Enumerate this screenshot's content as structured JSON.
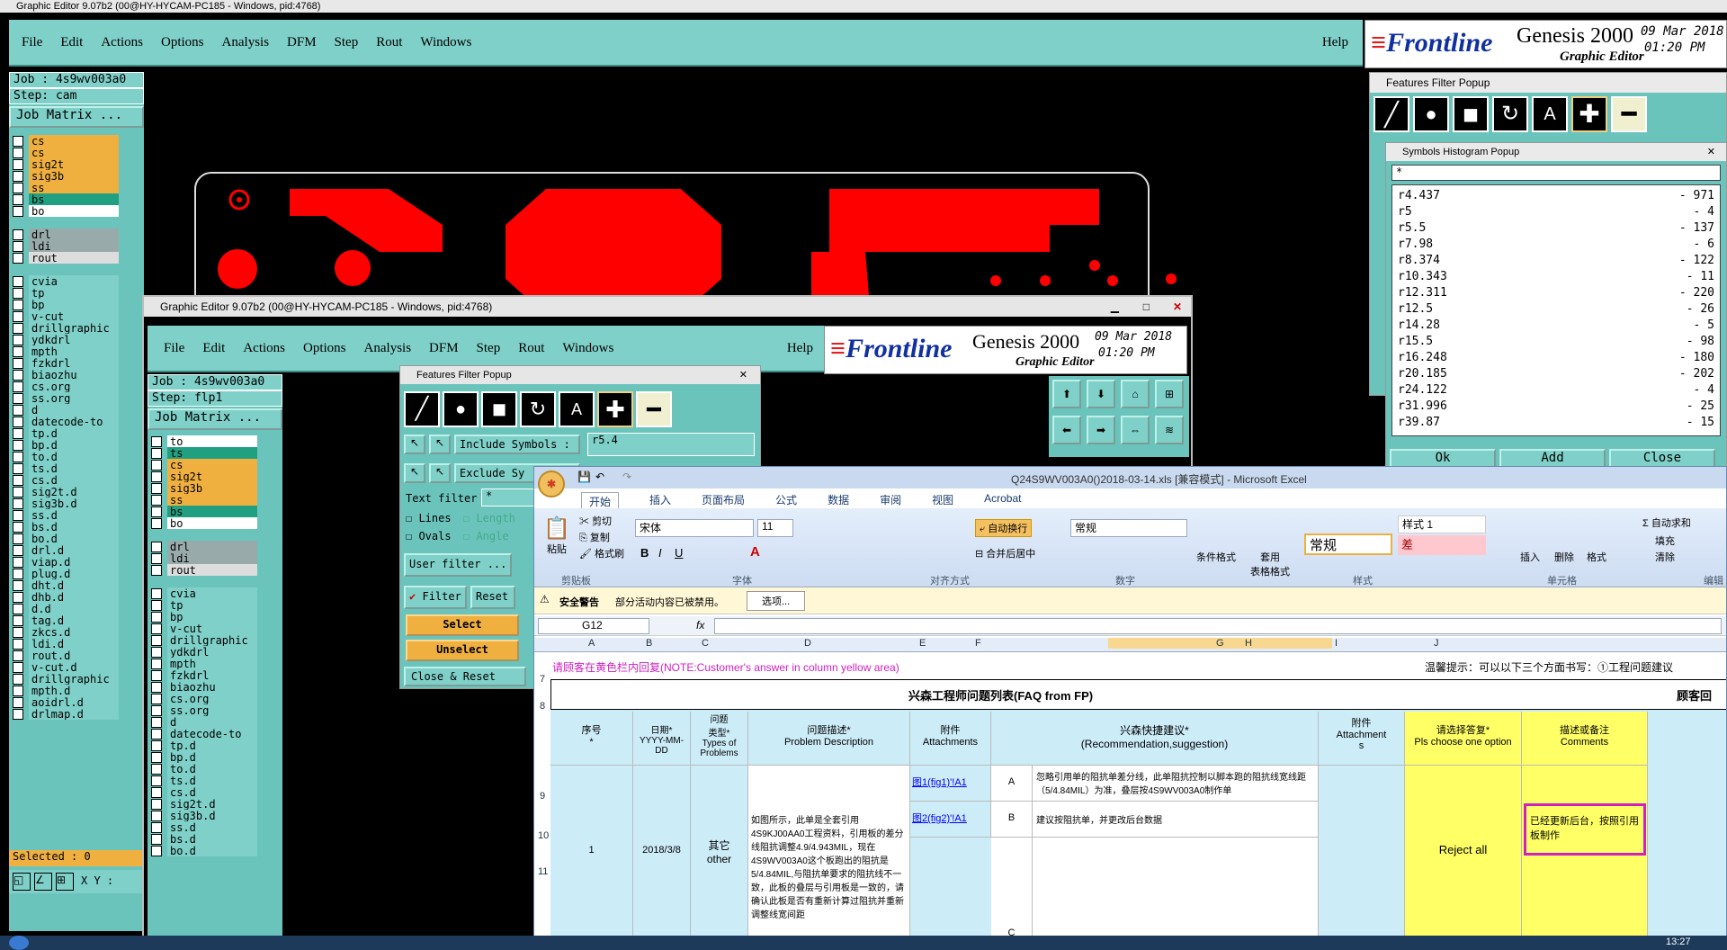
{
  "ge_back": {
    "title": "Graphic Editor 9.07b2 (00@HY-HYCAM-PC185 - Windows, pid:4768)",
    "menu": [
      "File",
      "Edit",
      "Actions",
      "Options",
      "Analysis",
      "DFM",
      "Step",
      "Rout",
      "Windows"
    ],
    "help": "Help",
    "job": "Job : 4s9wv003a0",
    "step": "Step: cam",
    "matrix": "Job Matrix ...",
    "selected": "Selected : 0",
    "xy": "X Y :",
    "layers": [
      {
        "n": "cs",
        "c": "#f0b040"
      },
      {
        "n": "cs",
        "c": "#f0b040"
      },
      {
        "n": "sig2t",
        "c": "#f0b040"
      },
      {
        "n": "sig3b",
        "c": "#f0b040"
      },
      {
        "n": "ss",
        "c": "#f0b040"
      },
      {
        "n": "bs",
        "c": "#20a080"
      },
      {
        "n": "bo",
        "c": "#ffffff"
      },
      {
        "n": "",
        "c": ""
      },
      {
        "n": "drl",
        "c": "#9aa"
      },
      {
        "n": "ldi",
        "c": "#9aa"
      },
      {
        "n": "rout",
        "c": "#ddd"
      },
      {
        "n": "",
        "c": ""
      },
      {
        "n": "cvia",
        "c": "#7fd0c8"
      },
      {
        "n": "tp",
        "c": "#7fd0c8"
      },
      {
        "n": "bp",
        "c": "#7fd0c8"
      },
      {
        "n": "v-cut",
        "c": "#7fd0c8"
      },
      {
        "n": "drillgraphic",
        "c": "#7fd0c8"
      },
      {
        "n": "ydkdrl",
        "c": "#7fd0c8"
      },
      {
        "n": "mpth",
        "c": "#7fd0c8"
      },
      {
        "n": "fzkdrl",
        "c": "#7fd0c8"
      },
      {
        "n": "biaozhu",
        "c": "#7fd0c8"
      },
      {
        "n": "cs.org",
        "c": "#7fd0c8"
      },
      {
        "n": "ss.org",
        "c": "#7fd0c8"
      },
      {
        "n": "d",
        "c": "#7fd0c8"
      },
      {
        "n": "datecode-to",
        "c": "#7fd0c8"
      },
      {
        "n": "tp.d",
        "c": "#7fd0c8"
      },
      {
        "n": "bp.d",
        "c": "#7fd0c8"
      },
      {
        "n": "to.d",
        "c": "#7fd0c8"
      },
      {
        "n": "ts.d",
        "c": "#7fd0c8"
      },
      {
        "n": "cs.d",
        "c": "#7fd0c8"
      },
      {
        "n": "sig2t.d",
        "c": "#7fd0c8"
      },
      {
        "n": "sig3b.d",
        "c": "#7fd0c8"
      },
      {
        "n": "ss.d",
        "c": "#7fd0c8"
      },
      {
        "n": "bs.d",
        "c": "#7fd0c8"
      },
      {
        "n": "bo.d",
        "c": "#7fd0c8"
      },
      {
        "n": "drl.d",
        "c": "#7fd0c8"
      },
      {
        "n": "viap.d",
        "c": "#7fd0c8"
      },
      {
        "n": "plug.d",
        "c": "#7fd0c8"
      },
      {
        "n": "dht.d",
        "c": "#7fd0c8"
      },
      {
        "n": "dhb.d",
        "c": "#7fd0c8"
      },
      {
        "n": "d.d",
        "c": "#7fd0c8"
      },
      {
        "n": "tag.d",
        "c": "#7fd0c8"
      },
      {
        "n": "zkcs.d",
        "c": "#7fd0c8"
      },
      {
        "n": "ldi.d",
        "c": "#7fd0c8"
      },
      {
        "n": "rout.d",
        "c": "#7fd0c8"
      },
      {
        "n": "v-cut.d",
        "c": "#7fd0c8"
      },
      {
        "n": "drillgraphic",
        "c": "#7fd0c8"
      },
      {
        "n": "mpth.d",
        "c": "#7fd0c8"
      },
      {
        "n": "aoidrl.d",
        "c": "#7fd0c8"
      },
      {
        "n": "drlmap.d",
        "c": "#7fd0c8"
      }
    ]
  },
  "frontline": {
    "brand": "Frontline",
    "product": "Genesis 2000",
    "sub": "Graphic Editor",
    "date": "09 Mar 2018",
    "time": "01:20 PM"
  },
  "ge_front": {
    "title": "Graphic Editor 9.07b2 (00@HY-HYCAM-PC185 - Windows, pid:4768)",
    "job": "Job : 4s9wv003a0",
    "step": "Step: flp1",
    "matrix": "Job Matrix ...",
    "layers": [
      {
        "n": "to",
        "c": "#ffffff"
      },
      {
        "n": "ts",
        "c": "#20a080"
      },
      {
        "n": "cs",
        "c": "#f0b040"
      },
      {
        "n": "sig2t",
        "c": "#f0b040"
      },
      {
        "n": "sig3b",
        "c": "#f0b040"
      },
      {
        "n": "ss",
        "c": "#f0b040"
      },
      {
        "n": "bs",
        "c": "#20a080"
      },
      {
        "n": "bo",
        "c": "#ffffff"
      },
      {
        "n": "",
        "c": ""
      },
      {
        "n": "drl",
        "c": "#9aa"
      },
      {
        "n": "ldi",
        "c": "#9aa"
      },
      {
        "n": "rout",
        "c": "#ddd"
      },
      {
        "n": "",
        "c": ""
      },
      {
        "n": "cvia",
        "c": "#7fd0c8"
      },
      {
        "n": "tp",
        "c": "#7fd0c8"
      },
      {
        "n": "bp",
        "c": "#7fd0c8"
      },
      {
        "n": "v-cut",
        "c": "#7fd0c8"
      },
      {
        "n": "drillgraphic",
        "c": "#7fd0c8"
      },
      {
        "n": "ydkdrl",
        "c": "#7fd0c8"
      },
      {
        "n": "mpth",
        "c": "#7fd0c8"
      },
      {
        "n": "fzkdrl",
        "c": "#7fd0c8"
      },
      {
        "n": "biaozhu",
        "c": "#7fd0c8"
      },
      {
        "n": "cs.org",
        "c": "#7fd0c8"
      },
      {
        "n": "ss.org",
        "c": "#7fd0c8"
      },
      {
        "n": "d",
        "c": "#7fd0c8"
      },
      {
        "n": "datecode-to",
        "c": "#7fd0c8"
      },
      {
        "n": "tp.d",
        "c": "#7fd0c8"
      },
      {
        "n": "bp.d",
        "c": "#7fd0c8"
      },
      {
        "n": "to.d",
        "c": "#7fd0c8"
      },
      {
        "n": "ts.d",
        "c": "#7fd0c8"
      },
      {
        "n": "cs.d",
        "c": "#7fd0c8"
      },
      {
        "n": "sig2t.d",
        "c": "#7fd0c8"
      },
      {
        "n": "sig3b.d",
        "c": "#7fd0c8"
      },
      {
        "n": "ss.d",
        "c": "#7fd0c8"
      },
      {
        "n": "bs.d",
        "c": "#7fd0c8"
      },
      {
        "n": "bo.d",
        "c": "#7fd0c8"
      }
    ]
  },
  "ffp_small": {
    "title": "Features Filter Popup",
    "include": "Include Symbols :",
    "include_val": "r5.4",
    "exclude": "Exclude Sy",
    "text_filter": "Text filter",
    "text_val": "*",
    "lines": "Lines",
    "length": "Length",
    "ovals": "Ovals",
    "angle": "Angle",
    "user_filter": "User filter ...",
    "filter": "Filter",
    "reset": "Reset",
    "select": "Select",
    "unselect": "Unselect",
    "close": "Close & Reset"
  },
  "ffp_right": {
    "title": "Features Filter Popup"
  },
  "histo": {
    "title": "Symbols Histogram Popup",
    "filter": "*",
    "rows": [
      {
        "s": "r4.437",
        "c": "- 971"
      },
      {
        "s": "r5",
        "c": "- 4"
      },
      {
        "s": "r5.5",
        "c": "- 137"
      },
      {
        "s": "r7.98",
        "c": "- 6"
      },
      {
        "s": "r8.374",
        "c": "- 122"
      },
      {
        "s": "r10.343",
        "c": "- 11"
      },
      {
        "s": "r12.311",
        "c": "- 220"
      },
      {
        "s": "r12.5",
        "c": "- 26"
      },
      {
        "s": "r14.28",
        "c": "- 5"
      },
      {
        "s": "r15.5",
        "c": "- 98"
      },
      {
        "s": "r16.248",
        "c": "- 180"
      },
      {
        "s": "r20.185",
        "c": "- 202"
      },
      {
        "s": "r24.122",
        "c": "- 4"
      },
      {
        "s": "r31.996",
        "c": "- 25"
      },
      {
        "s": "r39.87",
        "c": "- 15"
      }
    ],
    "ok": "Ok",
    "add": "Add",
    "close": "Close"
  },
  "excel": {
    "title": "Q24S9WV003A0()2018-03-14.xls  [兼容模式] - Microsoft Excel",
    "tabs": [
      "开始",
      "插入",
      "页面布局",
      "公式",
      "数据",
      "审阅",
      "视图",
      "Acrobat"
    ],
    "clip": {
      "paste": "粘贴",
      "cut": "剪切",
      "copy": "复制",
      "fmt": "格式刷",
      "group": "剪贴板"
    },
    "font": {
      "name": "宋体",
      "size": "11",
      "group": "字体"
    },
    "align": {
      "wrap": "自动换行",
      "merge": "合并后居中",
      "group": "对齐方式"
    },
    "number": {
      "fmt": "常规",
      "group": "数字"
    },
    "styles": {
      "cond": "条件格式",
      "table": "套用\n表格格式",
      "normal": "常规",
      "s1": "样式 1",
      "bad": "差",
      "group": "样式"
    },
    "cells": {
      "ins": "插入",
      "del": "删除",
      "fmt": "格式",
      "group": "单元格"
    },
    "edit": {
      "sum": "Σ 自动求和",
      "fill": "填充",
      "clear": "清除",
      "group": "编辑"
    },
    "security": {
      "label": "安全警告",
      "msg": "部分活动内容已被禁用。",
      "btn": "选项..."
    },
    "namebox": "G12",
    "fx": "fx",
    "cols": [
      "A",
      "B",
      "C",
      "D",
      "E",
      "F",
      "G",
      "H",
      "I",
      "J"
    ],
    "r7a": "请顾客在黄色栏内回复(NOTE:Customer's answer in column yellow area)",
    "r7b": "温馨提示：可以以下三个方面书写：①工程问题建议",
    "r8": "兴森工程师问题列表(FAQ from FP)",
    "r8b": "顾客回",
    "h_no": "序号\n*",
    "h_date": "日期*\nYYYY-MM-DD",
    "h_type": "问题\n类型*\nTypes of\nProblems",
    "h_desc": "问题描述*\nProblem Description",
    "h_att": "附件\nAttachments",
    "h_rec": "兴森快捷建议*\n(Recommendation,suggestion)",
    "h_att2": "附件\nAttachment\ns",
    "h_ans": "请选择答复*\nPls choose one option",
    "h_cmt": "描述或备注\nComments",
    "no": "1",
    "date": "2018/3/8",
    "type": "其它\nother",
    "desc": "如图所示，此单是全套引用4S9KJ00AA0工程资料，引用板的差分线阻抗调整4.9/4.943MIL，现在4S9WV003A0这个板跑出的阻抗是5/4.84MIL,与阻抗单要求的阻抗线不一致，此板的叠层与引用板是一致的，请确认此板是否有重新计算过阻抗并重新调整线宽间距",
    "link1": "图1(fig1)'!A1",
    "link2": "图2(fig2)'!A1",
    "optA": "A",
    "optB": "B",
    "optC": "C",
    "recA": "忽略引用单的阻抗单差分线，此单阻抗控制以脚本跑的阻抗线宽线距（5/4.84MIL）为准，叠层按4S9WV003A0制作单",
    "recB": "建议按阻抗单，并更改后台数据",
    "ans": "Reject all",
    "cmt": "已经更新后台，按照引用板制作"
  },
  "taskbar": {
    "time": "13:27"
  }
}
